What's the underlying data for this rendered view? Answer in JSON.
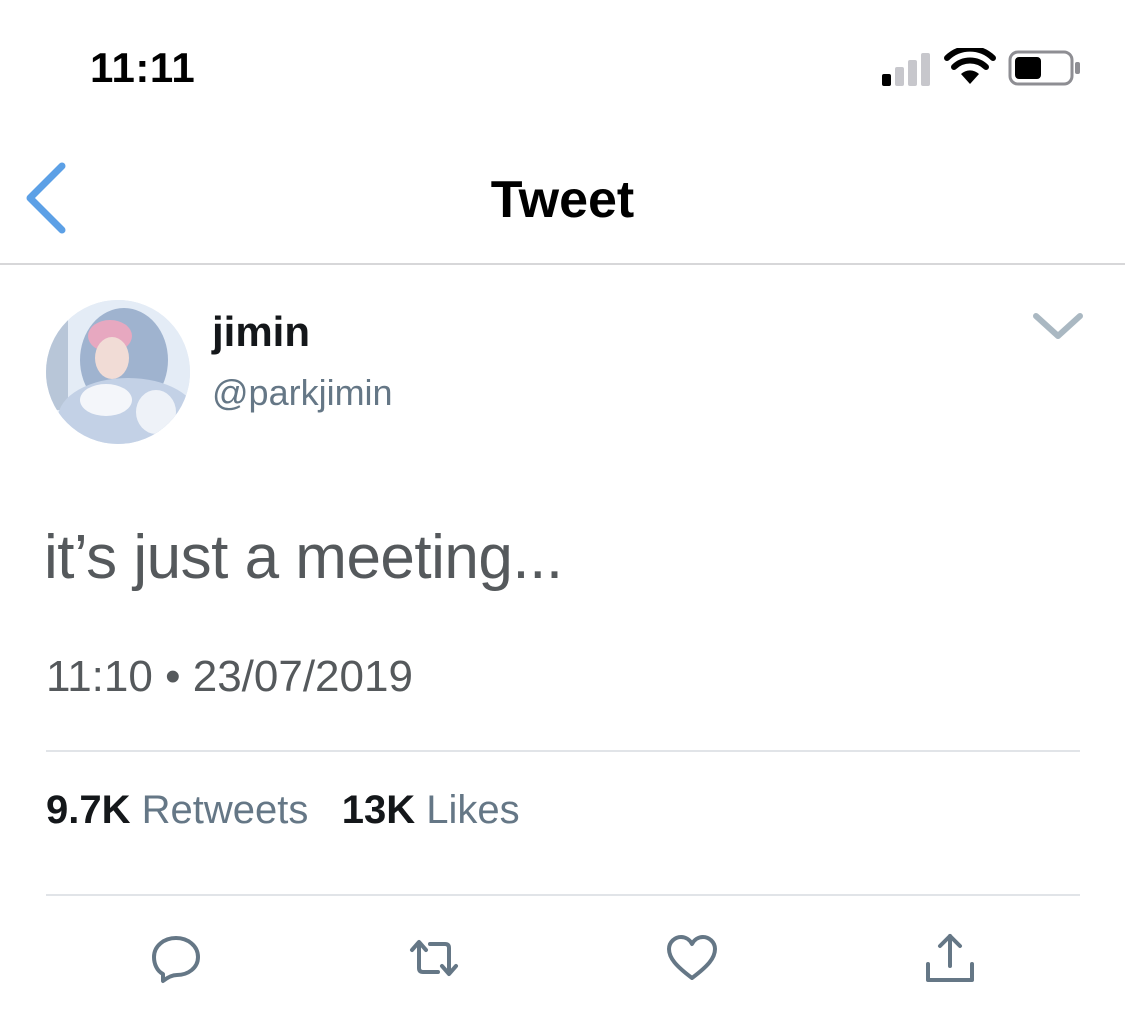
{
  "status_bar": {
    "time": "11:11"
  },
  "nav": {
    "title": "Tweet"
  },
  "tweet": {
    "display_name": "jimin",
    "handle": "@parkjimin",
    "text": "it’s just a meeting...",
    "time": "11:10",
    "separator": "•",
    "date": "23/07/2019"
  },
  "stats": {
    "retweets_count": "9.7K",
    "retweets_label": "Retweets",
    "likes_count": "13K",
    "likes_label": "Likes"
  },
  "icons": {
    "back": "chevron-left-icon",
    "caret": "chevron-down-icon",
    "reply": "reply-icon",
    "retweet": "retweet-icon",
    "like": "heart-icon",
    "share": "share-icon"
  },
  "colors": {
    "accent": "#5ca0e6",
    "icon_gray": "#657786",
    "text": "#14171a"
  }
}
